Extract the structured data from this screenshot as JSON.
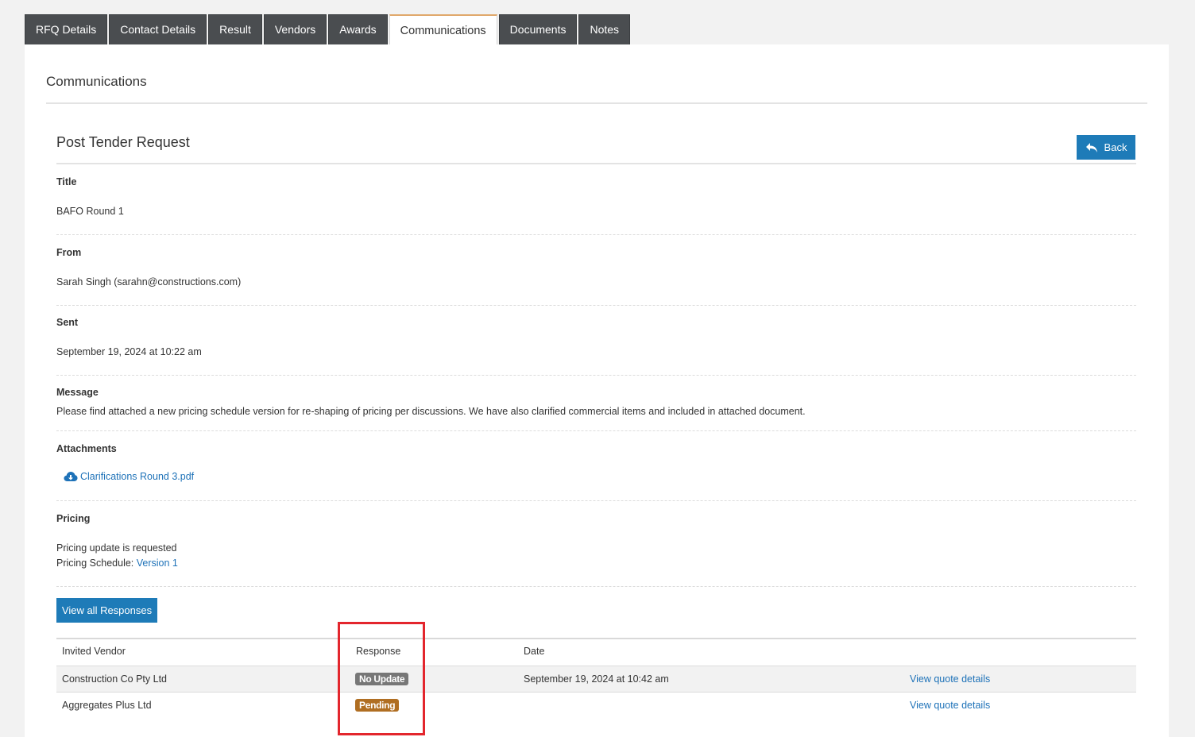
{
  "tabs": [
    "RFQ Details",
    "Contact Details",
    "Result",
    "Vendors",
    "Awards",
    "Communications",
    "Documents",
    "Notes"
  ],
  "active_tab": "Communications",
  "panel_title": "Communications",
  "request": {
    "title": "Post Tender Request",
    "back_label": "Back",
    "fields": {
      "title_label": "Title",
      "title_value": "BAFO Round 1",
      "from_label": "From",
      "from_value": "Sarah Singh (sarahn@constructions.com)",
      "sent_label": "Sent",
      "sent_value": "September 19, 2024 at 10:22 am",
      "message_label": "Message",
      "message_value": "Please find attached a new pricing schedule version for re-shaping of pricing per discussions. We have also clarified commercial items and included in attached document.",
      "attachments_label": "Attachments",
      "attachment_name": "Clarifications Round 3.pdf",
      "pricing_label": "Pricing",
      "pricing_line1": "Pricing update is requested",
      "pricing_schedule_prefix": "Pricing Schedule:",
      "pricing_schedule_link": "Version 1"
    },
    "view_all_label": "View all Responses"
  },
  "responses": {
    "headers": {
      "vendor": "Invited Vendor",
      "response": "Response",
      "date": "Date"
    },
    "rows": [
      {
        "vendor": "Construction Co Pty Ltd",
        "response": "No Update",
        "date": "September 19, 2024 at 10:42 am",
        "action": "View quote details"
      },
      {
        "vendor": "Aggregates Plus Ltd",
        "response": "Pending",
        "date": "",
        "action": "View quote details"
      }
    ]
  },
  "colors": {
    "accent": "#1e7bb8",
    "tab_bg": "#4a4d50",
    "badge_no_update": "#777777",
    "badge_pending": "#b06e22",
    "highlight": "#e3262d"
  }
}
